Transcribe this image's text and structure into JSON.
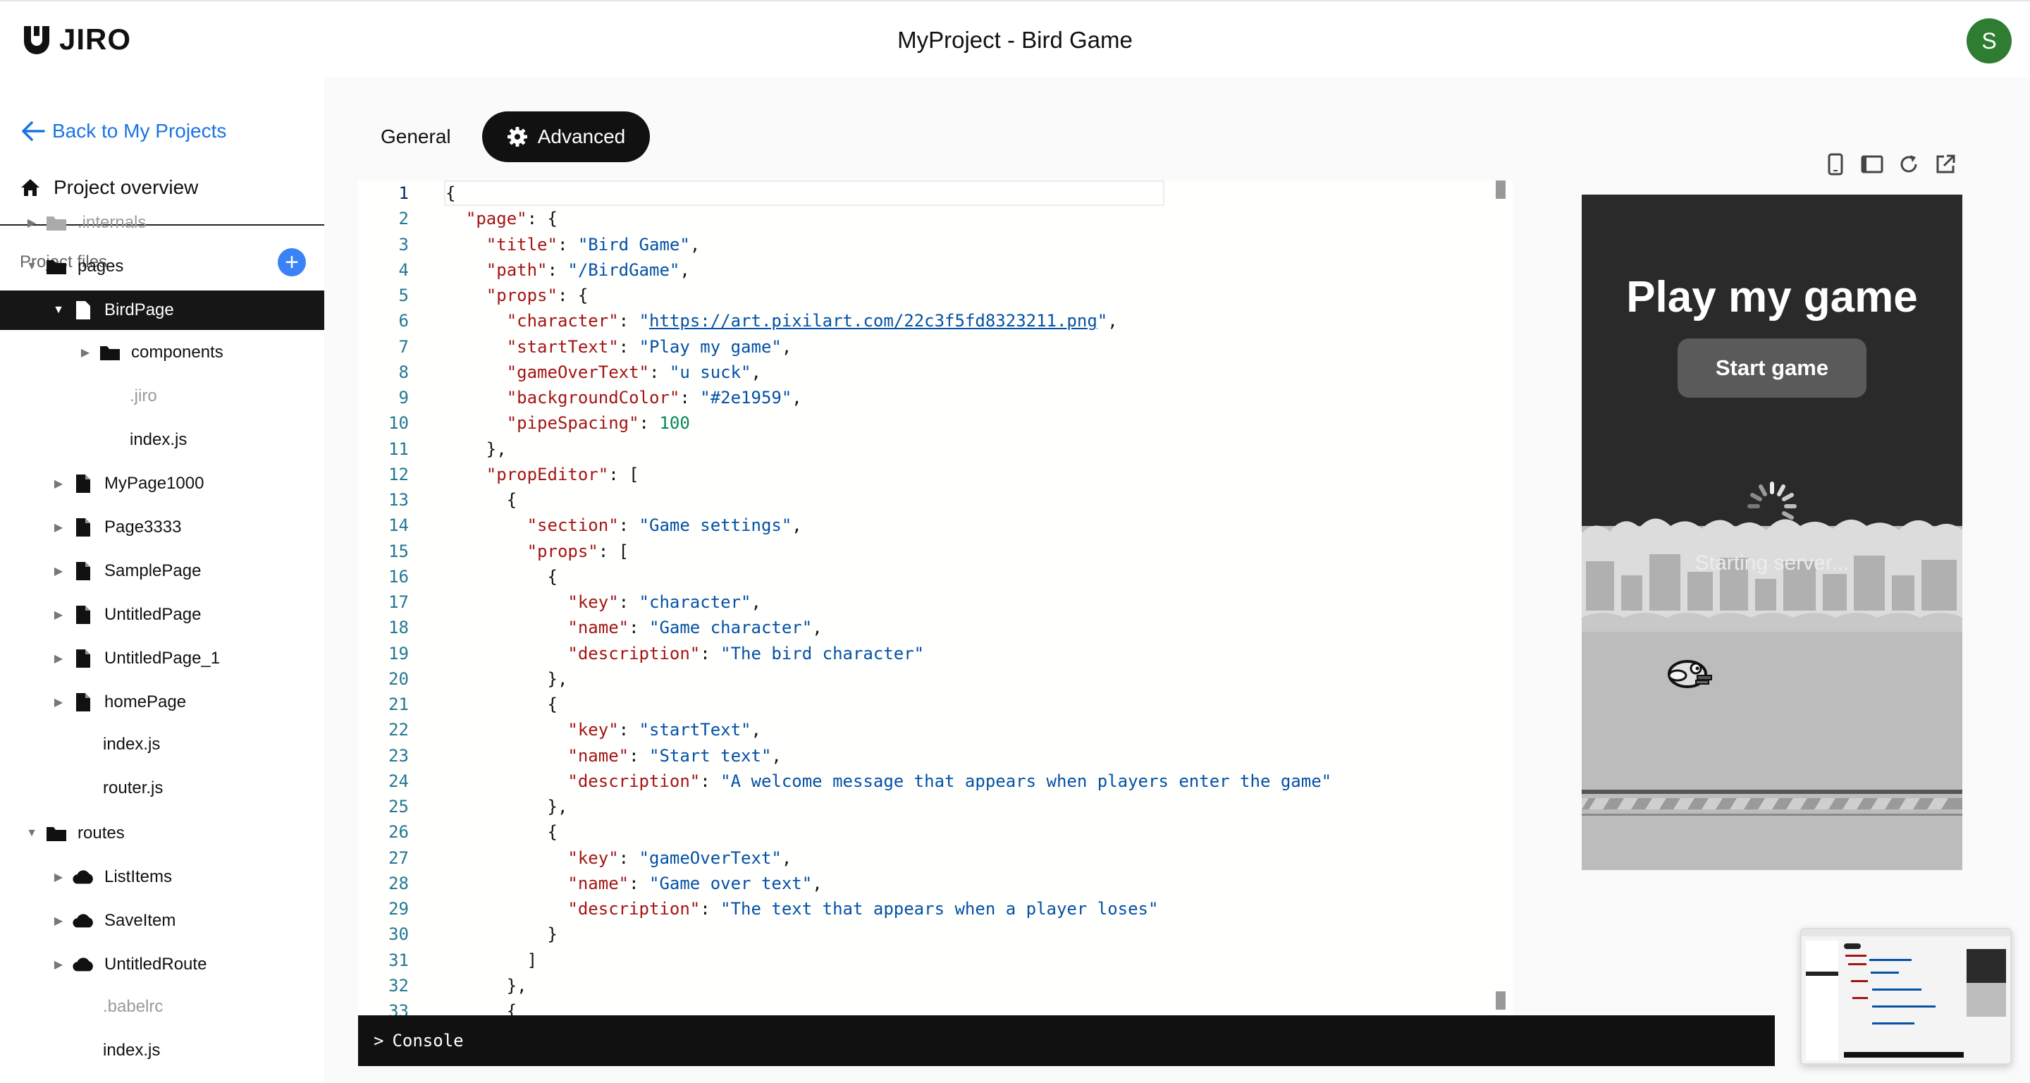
{
  "header": {
    "logo_text": "JIRO",
    "title": "MyProject - Bird Game",
    "avatar_letter": "S",
    "avatar_color": "#2e7d32"
  },
  "sidebar": {
    "back_label": "Back to My Projects",
    "overview_label": "Project overview",
    "files_label": "Project files",
    "add_label": "+",
    "tree": [
      {
        "label": ".internals",
        "type": "folder",
        "arrow": "▶",
        "muted": true
      },
      {
        "label": "pages",
        "type": "folder",
        "arrow": "▼"
      },
      {
        "label": "BirdPage",
        "type": "file",
        "arrow": "▼",
        "selected": true
      },
      {
        "label": "components",
        "type": "folder",
        "arrow": "▶"
      },
      {
        "label": ".jiro",
        "type": "none",
        "arrow": "",
        "muted": true
      },
      {
        "label": "index.js",
        "type": "none",
        "arrow": ""
      },
      {
        "label": "MyPage1000",
        "type": "file",
        "arrow": "▶"
      },
      {
        "label": "Page3333",
        "type": "file",
        "arrow": "▶"
      },
      {
        "label": "SamplePage",
        "type": "file",
        "arrow": "▶"
      },
      {
        "label": "UntitledPage",
        "type": "file",
        "arrow": "▶"
      },
      {
        "label": "UntitledPage_1",
        "type": "file",
        "arrow": "▶"
      },
      {
        "label": "homePage",
        "type": "file",
        "arrow": "▶"
      },
      {
        "label": "index.js",
        "type": "none",
        "arrow": ""
      },
      {
        "label": "router.js",
        "type": "none",
        "arrow": ""
      },
      {
        "label": "routes",
        "type": "folder",
        "arrow": "▼"
      },
      {
        "label": "ListItems",
        "type": "cloud",
        "arrow": "▶"
      },
      {
        "label": "SaveItem",
        "type": "cloud",
        "arrow": "▶"
      },
      {
        "label": "UntitledRoute",
        "type": "cloud",
        "arrow": "▶"
      },
      {
        "label": ".babelrc",
        "type": "none",
        "arrow": "",
        "muted": true
      },
      {
        "label": "index.js",
        "type": "none",
        "arrow": ""
      }
    ]
  },
  "tabs": {
    "general": "General",
    "advanced": "Advanced"
  },
  "editor": {
    "lines": [
      [
        [
          "p",
          "{"
        ]
      ],
      [
        [
          "p",
          "  "
        ],
        [
          "k",
          "\"page\""
        ],
        [
          "p",
          ": {"
        ]
      ],
      [
        [
          "p",
          "    "
        ],
        [
          "k",
          "\"title\""
        ],
        [
          "p",
          ": "
        ],
        [
          "s",
          "\"Bird Game\""
        ],
        [
          "p",
          ","
        ]
      ],
      [
        [
          "p",
          "    "
        ],
        [
          "k",
          "\"path\""
        ],
        [
          "p",
          ": "
        ],
        [
          "s",
          "\"/BirdGame\""
        ],
        [
          "p",
          ","
        ]
      ],
      [
        [
          "p",
          "    "
        ],
        [
          "k",
          "\"props\""
        ],
        [
          "p",
          ": {"
        ]
      ],
      [
        [
          "p",
          "      "
        ],
        [
          "k",
          "\"character\""
        ],
        [
          "p",
          ": "
        ],
        [
          "s",
          "\""
        ],
        [
          "u",
          "https://art.pixilart.com/22c3f5fd8323211.png"
        ],
        [
          "s",
          "\""
        ],
        [
          "p",
          ","
        ]
      ],
      [
        [
          "p",
          "      "
        ],
        [
          "k",
          "\"startText\""
        ],
        [
          "p",
          ": "
        ],
        [
          "s",
          "\"Play my game\""
        ],
        [
          "p",
          ","
        ]
      ],
      [
        [
          "p",
          "      "
        ],
        [
          "k",
          "\"gameOverText\""
        ],
        [
          "p",
          ": "
        ],
        [
          "s",
          "\"u suck\""
        ],
        [
          "p",
          ","
        ]
      ],
      [
        [
          "p",
          "      "
        ],
        [
          "k",
          "\"backgroundColor\""
        ],
        [
          "p",
          ": "
        ],
        [
          "s",
          "\"#2e1959\""
        ],
        [
          "p",
          ","
        ]
      ],
      [
        [
          "p",
          "      "
        ],
        [
          "k",
          "\"pipeSpacing\""
        ],
        [
          "p",
          ": "
        ],
        [
          "n",
          "100"
        ]
      ],
      [
        [
          "p",
          "    },"
        ]
      ],
      [
        [
          "p",
          "    "
        ],
        [
          "k",
          "\"propEditor\""
        ],
        [
          "p",
          ": ["
        ]
      ],
      [
        [
          "p",
          "      {"
        ]
      ],
      [
        [
          "p",
          "        "
        ],
        [
          "k",
          "\"section\""
        ],
        [
          "p",
          ": "
        ],
        [
          "s",
          "\"Game settings\""
        ],
        [
          "p",
          ","
        ]
      ],
      [
        [
          "p",
          "        "
        ],
        [
          "k",
          "\"props\""
        ],
        [
          "p",
          ": ["
        ]
      ],
      [
        [
          "p",
          "          {"
        ]
      ],
      [
        [
          "p",
          "            "
        ],
        [
          "k",
          "\"key\""
        ],
        [
          "p",
          ": "
        ],
        [
          "s",
          "\"character\""
        ],
        [
          "p",
          ","
        ]
      ],
      [
        [
          "p",
          "            "
        ],
        [
          "k",
          "\"name\""
        ],
        [
          "p",
          ": "
        ],
        [
          "s",
          "\"Game character\""
        ],
        [
          "p",
          ","
        ]
      ],
      [
        [
          "p",
          "            "
        ],
        [
          "k",
          "\"description\""
        ],
        [
          "p",
          ": "
        ],
        [
          "s",
          "\"The bird character\""
        ]
      ],
      [
        [
          "p",
          "          },"
        ]
      ],
      [
        [
          "p",
          "          {"
        ]
      ],
      [
        [
          "p",
          "            "
        ],
        [
          "k",
          "\"key\""
        ],
        [
          "p",
          ": "
        ],
        [
          "s",
          "\"startText\""
        ],
        [
          "p",
          ","
        ]
      ],
      [
        [
          "p",
          "            "
        ],
        [
          "k",
          "\"name\""
        ],
        [
          "p",
          ": "
        ],
        [
          "s",
          "\"Start text\""
        ],
        [
          "p",
          ","
        ]
      ],
      [
        [
          "p",
          "            "
        ],
        [
          "k",
          "\"description\""
        ],
        [
          "p",
          ": "
        ],
        [
          "s",
          "\"A welcome message that appears when players enter the game\""
        ]
      ],
      [
        [
          "p",
          "          },"
        ]
      ],
      [
        [
          "p",
          "          {"
        ]
      ],
      [
        [
          "p",
          "            "
        ],
        [
          "k",
          "\"key\""
        ],
        [
          "p",
          ": "
        ],
        [
          "s",
          "\"gameOverText\""
        ],
        [
          "p",
          ","
        ]
      ],
      [
        [
          "p",
          "            "
        ],
        [
          "k",
          "\"name\""
        ],
        [
          "p",
          ": "
        ],
        [
          "s",
          "\"Game over text\""
        ],
        [
          "p",
          ","
        ]
      ],
      [
        [
          "p",
          "            "
        ],
        [
          "k",
          "\"description\""
        ],
        [
          "p",
          ": "
        ],
        [
          "s",
          "\"The text that appears when a player loses\""
        ]
      ],
      [
        [
          "p",
          "          }"
        ]
      ],
      [
        [
          "p",
          "        ]"
        ]
      ],
      [
        [
          "p",
          "      },"
        ]
      ],
      [
        [
          "p",
          "      {"
        ]
      ]
    ]
  },
  "console": {
    "chevron": ">",
    "label": "Console"
  },
  "preview": {
    "title": "Play my game",
    "button": "Start game",
    "status": "Starting server..."
  }
}
